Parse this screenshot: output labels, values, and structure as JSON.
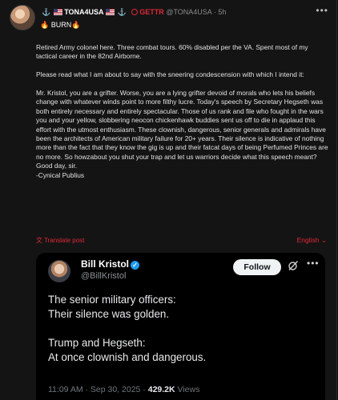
{
  "post": {
    "author_name": "TONA4USA",
    "platform": "GETTR",
    "handle": "@TONA4USA",
    "separator": "·",
    "time": "5h",
    "more": "•••",
    "topic_text": "BURN",
    "topic_emoji": "🔥",
    "body": "Retired Army colonel here. Three combat tours. 60% disabled per the VA. Spent most of my tactical career in the 82nd Airborne.\n\nPlease read what I am about to say with the sneering condescension with which I intend it:\n\nMr. Kristol, you are a grifter. Worse, you are a lying grifter devoid of morals who lets his beliefs change with whatever winds point to more filthy lucre. Today's speech by Secretary Hegseth was both entirely necessary and entirely spectacular. Those of us rank and file who fought in the wars you and your yellow, slobbering neocon chickenhawk buddies sent us off to die in applaud this effort with the utmost enthusiasm. These clownish, dangerous, senior generals and admirals have been the architects of American military failure for 20+ years. Their silence is indicative of nothing more than the fact that they know the gig is up and their fatcat days of being Perfumed Princes are no more. So howzabout you shut your trap and let us warriors decide what this speech meant? Good day, sir.\n-Cynical Publius",
    "translate_label": "Translate post",
    "language_label": "English"
  },
  "embed": {
    "name": "Bill Kristol",
    "handle": "@BillKristol",
    "follow_label": "Follow",
    "more": "•••",
    "text": "The senior military officers:\nTheir silence was golden.\n\nTrump and Hegseth:\nAt once clownish and dangerous.",
    "timestamp": "11:09 AM · Sep 30, 2025 ·",
    "views_count": "429.2K",
    "views_label": "Views"
  },
  "colors": {
    "accent_red": "#e0283a",
    "verified_blue": "#1d9bf0",
    "anchor_blue": "#4aa3ff"
  }
}
